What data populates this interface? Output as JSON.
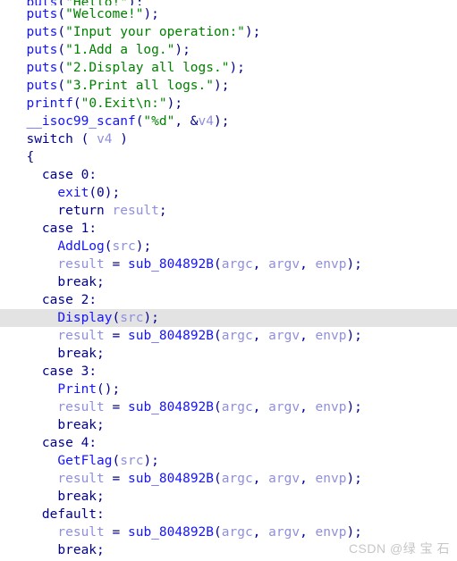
{
  "view": {
    "name": "hex-rays-pseudocode-view",
    "background_color": "#ffffff",
    "highlight_color": "#e3e3e3",
    "highlighted_line_index": 18
  },
  "syntax_colors": {
    "keyword": "#00008b",
    "function": "#1414ff",
    "string": "#008000",
    "variable": "#8f8fdd",
    "punctuation": "#00008b",
    "number": "#00008b"
  },
  "watermark": {
    "text": "CSDN @绿 宝 石",
    "color": "#c6c6c6"
  },
  "code": {
    "lines": [
      {
        "clipped": true,
        "tokens": [
          {
            "t": "  ",
            "c": "plain"
          },
          {
            "t": "puts",
            "c": "fn"
          },
          {
            "t": "(",
            "c": "plain"
          },
          {
            "t": "\"Hello!\"",
            "c": "str"
          },
          {
            "t": ");",
            "c": "plain"
          }
        ]
      },
      {
        "tokens": [
          {
            "t": "  ",
            "c": "plain"
          },
          {
            "t": "puts",
            "c": "fn"
          },
          {
            "t": "(",
            "c": "plain"
          },
          {
            "t": "\"Welcome!\"",
            "c": "str"
          },
          {
            "t": ");",
            "c": "plain"
          }
        ]
      },
      {
        "tokens": [
          {
            "t": "  ",
            "c": "plain"
          },
          {
            "t": "puts",
            "c": "fn"
          },
          {
            "t": "(",
            "c": "plain"
          },
          {
            "t": "\"Input your operation:\"",
            "c": "str"
          },
          {
            "t": ");",
            "c": "plain"
          }
        ]
      },
      {
        "tokens": [
          {
            "t": "  ",
            "c": "plain"
          },
          {
            "t": "puts",
            "c": "fn"
          },
          {
            "t": "(",
            "c": "plain"
          },
          {
            "t": "\"1.Add a log.\"",
            "c": "str"
          },
          {
            "t": ");",
            "c": "plain"
          }
        ]
      },
      {
        "tokens": [
          {
            "t": "  ",
            "c": "plain"
          },
          {
            "t": "puts",
            "c": "fn"
          },
          {
            "t": "(",
            "c": "plain"
          },
          {
            "t": "\"2.Display all logs.\"",
            "c": "str"
          },
          {
            "t": ");",
            "c": "plain"
          }
        ]
      },
      {
        "tokens": [
          {
            "t": "  ",
            "c": "plain"
          },
          {
            "t": "puts",
            "c": "fn"
          },
          {
            "t": "(",
            "c": "plain"
          },
          {
            "t": "\"3.Print all logs.\"",
            "c": "str"
          },
          {
            "t": ");",
            "c": "plain"
          }
        ]
      },
      {
        "tokens": [
          {
            "t": "  ",
            "c": "plain"
          },
          {
            "t": "printf",
            "c": "fn"
          },
          {
            "t": "(",
            "c": "plain"
          },
          {
            "t": "\"0.Exit\\n:\"",
            "c": "str"
          },
          {
            "t": ");",
            "c": "plain"
          }
        ]
      },
      {
        "tokens": [
          {
            "t": "  ",
            "c": "plain"
          },
          {
            "t": "__isoc99_scanf",
            "c": "fn"
          },
          {
            "t": "(",
            "c": "plain"
          },
          {
            "t": "\"%d\"",
            "c": "str"
          },
          {
            "t": ", &",
            "c": "plain"
          },
          {
            "t": "v4",
            "c": "var"
          },
          {
            "t": ");",
            "c": "plain"
          }
        ]
      },
      {
        "tokens": [
          {
            "t": "  ",
            "c": "plain"
          },
          {
            "t": "switch",
            "c": "kw"
          },
          {
            "t": " ( ",
            "c": "plain"
          },
          {
            "t": "v4",
            "c": "var"
          },
          {
            "t": " )",
            "c": "plain"
          }
        ]
      },
      {
        "tokens": [
          {
            "t": "  {",
            "c": "plain"
          }
        ]
      },
      {
        "tokens": [
          {
            "t": "    ",
            "c": "plain"
          },
          {
            "t": "case",
            "c": "kw"
          },
          {
            "t": " ",
            "c": "plain"
          },
          {
            "t": "0",
            "c": "num"
          },
          {
            "t": ":",
            "c": "plain"
          }
        ]
      },
      {
        "tokens": [
          {
            "t": "      ",
            "c": "plain"
          },
          {
            "t": "exit",
            "c": "fn"
          },
          {
            "t": "(",
            "c": "plain"
          },
          {
            "t": "0",
            "c": "num"
          },
          {
            "t": ");",
            "c": "plain"
          }
        ]
      },
      {
        "tokens": [
          {
            "t": "      ",
            "c": "plain"
          },
          {
            "t": "return",
            "c": "kw"
          },
          {
            "t": " ",
            "c": "plain"
          },
          {
            "t": "result",
            "c": "var"
          },
          {
            "t": ";",
            "c": "plain"
          }
        ]
      },
      {
        "tokens": [
          {
            "t": "    ",
            "c": "plain"
          },
          {
            "t": "case",
            "c": "kw"
          },
          {
            "t": " ",
            "c": "plain"
          },
          {
            "t": "1",
            "c": "num"
          },
          {
            "t": ":",
            "c": "plain"
          }
        ]
      },
      {
        "tokens": [
          {
            "t": "      ",
            "c": "plain"
          },
          {
            "t": "AddLog",
            "c": "fn"
          },
          {
            "t": "(",
            "c": "plain"
          },
          {
            "t": "src",
            "c": "var"
          },
          {
            "t": ");",
            "c": "plain"
          }
        ]
      },
      {
        "tokens": [
          {
            "t": "      ",
            "c": "plain"
          },
          {
            "t": "result",
            "c": "var"
          },
          {
            "t": " = ",
            "c": "plain"
          },
          {
            "t": "sub_804892B",
            "c": "fn"
          },
          {
            "t": "(",
            "c": "plain"
          },
          {
            "t": "argc",
            "c": "var"
          },
          {
            "t": ", ",
            "c": "plain"
          },
          {
            "t": "argv",
            "c": "var"
          },
          {
            "t": ", ",
            "c": "plain"
          },
          {
            "t": "envp",
            "c": "var"
          },
          {
            "t": ");",
            "c": "plain"
          }
        ]
      },
      {
        "tokens": [
          {
            "t": "      ",
            "c": "plain"
          },
          {
            "t": "break",
            "c": "kw"
          },
          {
            "t": ";",
            "c": "plain"
          }
        ]
      },
      {
        "tokens": [
          {
            "t": "    ",
            "c": "plain"
          },
          {
            "t": "case",
            "c": "kw"
          },
          {
            "t": " ",
            "c": "plain"
          },
          {
            "t": "2",
            "c": "num"
          },
          {
            "t": ":",
            "c": "plain"
          }
        ]
      },
      {
        "tokens": [
          {
            "t": "      ",
            "c": "plain"
          },
          {
            "t": "Display",
            "c": "fn"
          },
          {
            "t": "(",
            "c": "plain"
          },
          {
            "t": "src",
            "c": "var"
          },
          {
            "t": ");",
            "c": "plain"
          }
        ]
      },
      {
        "tokens": [
          {
            "t": "      ",
            "c": "plain"
          },
          {
            "t": "result",
            "c": "var"
          },
          {
            "t": " = ",
            "c": "plain"
          },
          {
            "t": "sub_804892B",
            "c": "fn"
          },
          {
            "t": "(",
            "c": "plain"
          },
          {
            "t": "argc",
            "c": "var"
          },
          {
            "t": ", ",
            "c": "plain"
          },
          {
            "t": "argv",
            "c": "var"
          },
          {
            "t": ", ",
            "c": "plain"
          },
          {
            "t": "envp",
            "c": "var"
          },
          {
            "t": ");",
            "c": "plain"
          }
        ]
      },
      {
        "tokens": [
          {
            "t": "      ",
            "c": "plain"
          },
          {
            "t": "break",
            "c": "kw"
          },
          {
            "t": ";",
            "c": "plain"
          }
        ]
      },
      {
        "tokens": [
          {
            "t": "    ",
            "c": "plain"
          },
          {
            "t": "case",
            "c": "kw"
          },
          {
            "t": " ",
            "c": "plain"
          },
          {
            "t": "3",
            "c": "num"
          },
          {
            "t": ":",
            "c": "plain"
          }
        ]
      },
      {
        "tokens": [
          {
            "t": "      ",
            "c": "plain"
          },
          {
            "t": "Print",
            "c": "fn"
          },
          {
            "t": "();",
            "c": "plain"
          }
        ]
      },
      {
        "tokens": [
          {
            "t": "      ",
            "c": "plain"
          },
          {
            "t": "result",
            "c": "var"
          },
          {
            "t": " = ",
            "c": "plain"
          },
          {
            "t": "sub_804892B",
            "c": "fn"
          },
          {
            "t": "(",
            "c": "plain"
          },
          {
            "t": "argc",
            "c": "var"
          },
          {
            "t": ", ",
            "c": "plain"
          },
          {
            "t": "argv",
            "c": "var"
          },
          {
            "t": ", ",
            "c": "plain"
          },
          {
            "t": "envp",
            "c": "var"
          },
          {
            "t": ");",
            "c": "plain"
          }
        ]
      },
      {
        "tokens": [
          {
            "t": "      ",
            "c": "plain"
          },
          {
            "t": "break",
            "c": "kw"
          },
          {
            "t": ";",
            "c": "plain"
          }
        ]
      },
      {
        "tokens": [
          {
            "t": "    ",
            "c": "plain"
          },
          {
            "t": "case",
            "c": "kw"
          },
          {
            "t": " ",
            "c": "plain"
          },
          {
            "t": "4",
            "c": "num"
          },
          {
            "t": ":",
            "c": "plain"
          }
        ]
      },
      {
        "tokens": [
          {
            "t": "      ",
            "c": "plain"
          },
          {
            "t": "GetFlag",
            "c": "fn"
          },
          {
            "t": "(",
            "c": "plain"
          },
          {
            "t": "src",
            "c": "var"
          },
          {
            "t": ");",
            "c": "plain"
          }
        ]
      },
      {
        "tokens": [
          {
            "t": "      ",
            "c": "plain"
          },
          {
            "t": "result",
            "c": "var"
          },
          {
            "t": " = ",
            "c": "plain"
          },
          {
            "t": "sub_804892B",
            "c": "fn"
          },
          {
            "t": "(",
            "c": "plain"
          },
          {
            "t": "argc",
            "c": "var"
          },
          {
            "t": ", ",
            "c": "plain"
          },
          {
            "t": "argv",
            "c": "var"
          },
          {
            "t": ", ",
            "c": "plain"
          },
          {
            "t": "envp",
            "c": "var"
          },
          {
            "t": ");",
            "c": "plain"
          }
        ]
      },
      {
        "tokens": [
          {
            "t": "      ",
            "c": "plain"
          },
          {
            "t": "break",
            "c": "kw"
          },
          {
            "t": ";",
            "c": "plain"
          }
        ]
      },
      {
        "tokens": [
          {
            "t": "    ",
            "c": "plain"
          },
          {
            "t": "default",
            "c": "kw"
          },
          {
            "t": ":",
            "c": "plain"
          }
        ]
      },
      {
        "tokens": [
          {
            "t": "      ",
            "c": "plain"
          },
          {
            "t": "result",
            "c": "var"
          },
          {
            "t": " = ",
            "c": "plain"
          },
          {
            "t": "sub_804892B",
            "c": "fn"
          },
          {
            "t": "(",
            "c": "plain"
          },
          {
            "t": "argc",
            "c": "var"
          },
          {
            "t": ", ",
            "c": "plain"
          },
          {
            "t": "argv",
            "c": "var"
          },
          {
            "t": ", ",
            "c": "plain"
          },
          {
            "t": "envp",
            "c": "var"
          },
          {
            "t": ");",
            "c": "plain"
          }
        ]
      },
      {
        "tokens": [
          {
            "t": "      ",
            "c": "plain"
          },
          {
            "t": "break",
            "c": "kw"
          },
          {
            "t": ";",
            "c": "plain"
          }
        ]
      }
    ]
  }
}
